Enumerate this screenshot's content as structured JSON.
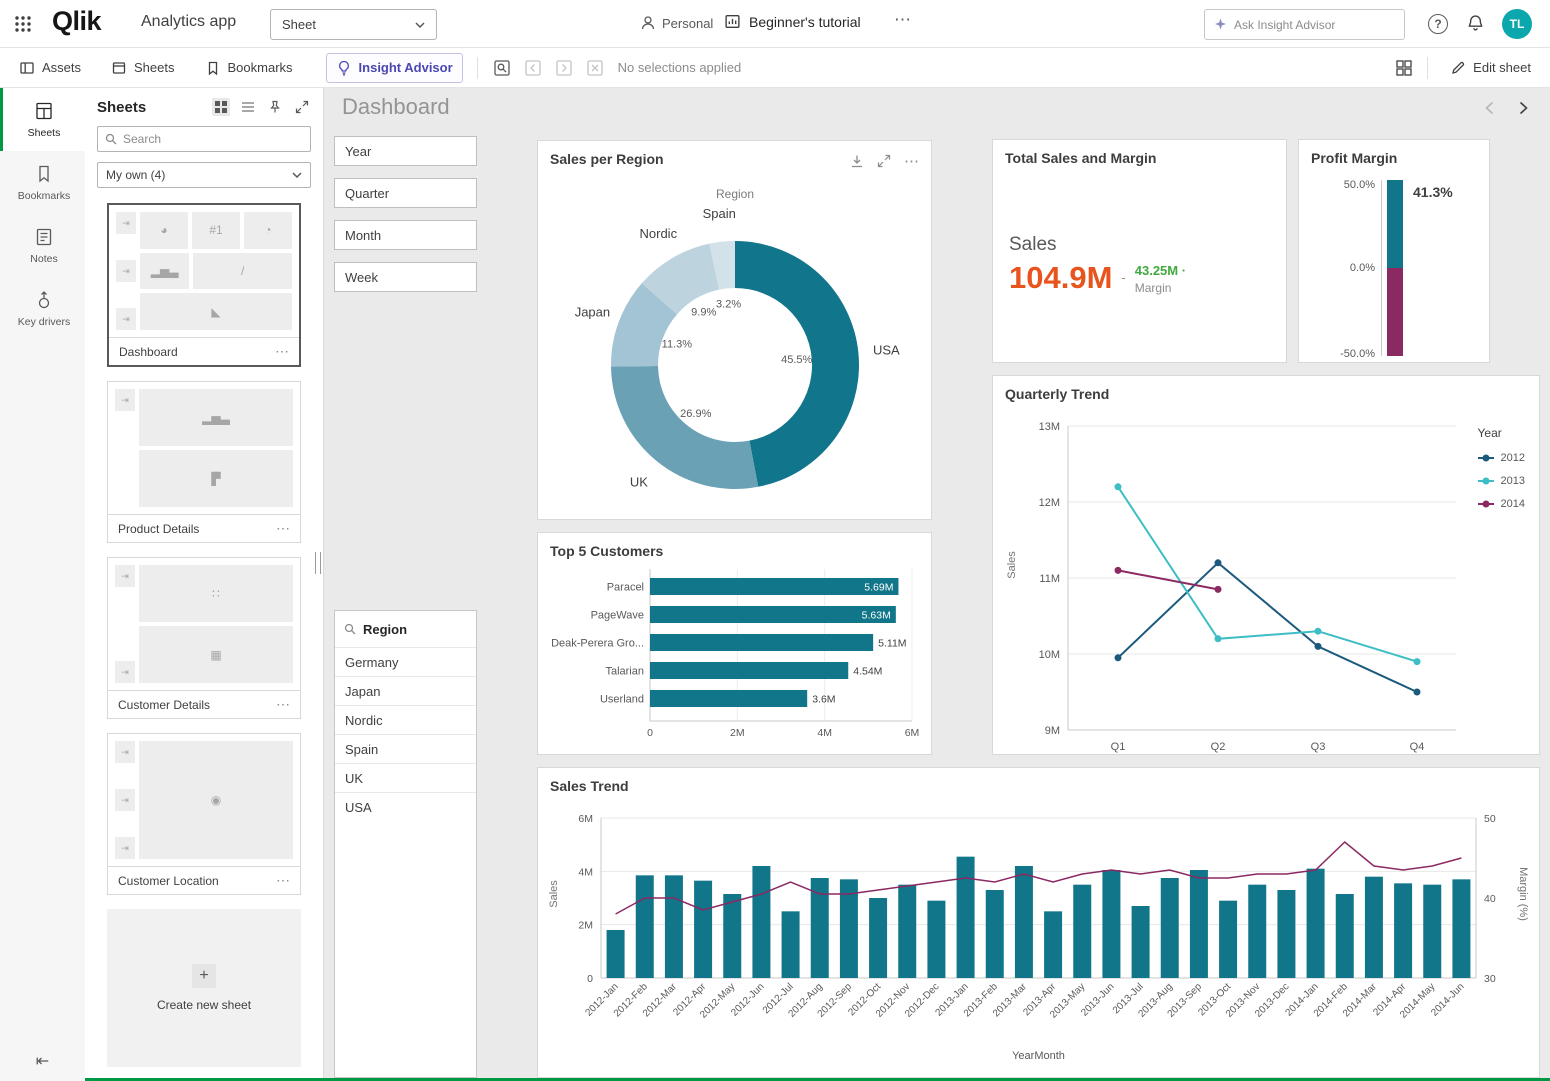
{
  "colors": {
    "accent_green": "#009845",
    "avatar_teal": "#0aa7ad",
    "insight_purple": "#4a47b3"
  },
  "topbar": {
    "logo_text": "Qlik",
    "app_name": "Analytics app",
    "sheet_selector_label": "Sheet",
    "personal_label": "Personal",
    "tutorial_label": "Beginner's tutorial",
    "insight_input_placeholder": "Ask Insight Advisor",
    "avatar_initials": "TL"
  },
  "toolbar": {
    "assets_label": "Assets",
    "sheets_label": "Sheets",
    "bookmarks_label": "Bookmarks",
    "insight_advisor_label": "Insight Advisor",
    "selection_status": "No selections applied",
    "edit_sheet_label": "Edit sheet"
  },
  "left_rail": {
    "items": [
      {
        "label": "Sheets",
        "active": true
      },
      {
        "label": "Bookmarks",
        "active": false
      },
      {
        "label": "Notes",
        "active": false
      },
      {
        "label": "Key drivers",
        "active": false
      }
    ]
  },
  "sheets_panel": {
    "title": "Sheets",
    "search_placeholder": "Search",
    "collection_filter": "My own (4)",
    "cards": [
      {
        "label": "Dashboard",
        "selected": true
      },
      {
        "label": "Product Details",
        "selected": false
      },
      {
        "label": "Customer Details",
        "selected": false
      },
      {
        "label": "Customer Location",
        "selected": false
      }
    ],
    "create_new_label": "Create new sheet"
  },
  "main": {
    "title": "Dashboard",
    "filter_boxes": [
      "Year",
      "Quarter",
      "Month",
      "Week"
    ],
    "region_listbox": {
      "title": "Region",
      "options": [
        "Germany",
        "Japan",
        "Nordic",
        "Spain",
        "UK",
        "USA"
      ]
    }
  },
  "chart_data": [
    {
      "id": "sales_per_region",
      "type": "pie",
      "donut": true,
      "title": "Sales per Region",
      "dimension_label": "Region",
      "labels": [
        "USA",
        "UK",
        "Japan",
        "Nordic",
        "Spain"
      ],
      "values": [
        45.5,
        26.9,
        11.3,
        9.9,
        3.2
      ],
      "value_labels": [
        "45.5%",
        "26.9%",
        "11.3%",
        "9.9%",
        "3.2%"
      ],
      "colors": [
        "#11758b",
        "#6aa1b5",
        "#a3c4d5",
        "#bdd3de",
        "#d3e1e9"
      ]
    },
    {
      "id": "total_sales_margin",
      "type": "kpi",
      "title": "Total Sales and Margin",
      "primary_label": "Sales",
      "primary_value": "104.9M",
      "primary_color": "#e8541d",
      "divider": "-",
      "secondary_value": "43.25M ·",
      "secondary_label": "Margin",
      "secondary_color": "#41a940"
    },
    {
      "id": "profit_margin",
      "type": "gauge",
      "title": "Profit Margin",
      "value": 41.3,
      "value_label": "41.3%",
      "min": -50,
      "max": 50,
      "ticks": [
        "50.0%",
        "0.0%",
        "-50.0%"
      ],
      "segments": [
        {
          "from": 0,
          "to": 50,
          "color": "#12768a"
        },
        {
          "from": -50,
          "to": 0,
          "color": "#8b2962"
        }
      ]
    },
    {
      "id": "quarterly_trend",
      "type": "line",
      "title": "Quarterly Trend",
      "x": [
        "Q1",
        "Q2",
        "Q3",
        "Q4"
      ],
      "ylabel": "Sales",
      "unit": "M",
      "ylim": [
        9,
        13
      ],
      "yticks": [
        "9M",
        "10M",
        "11M",
        "12M",
        "13M"
      ],
      "legend_title": "Year",
      "series": [
        {
          "name": "2012",
          "color": "#1b5a7d",
          "values": [
            9.95,
            11.2,
            10.1,
            9.5
          ]
        },
        {
          "name": "2013",
          "color": "#3dbdc5",
          "values": [
            12.2,
            10.2,
            10.3,
            9.9
          ]
        },
        {
          "name": "2014",
          "color": "#8b2962",
          "values": [
            11.1,
            10.85,
            null,
            null
          ]
        }
      ]
    },
    {
      "id": "top5_customers",
      "type": "bar",
      "orientation": "horizontal",
      "title": "Top 5 Customers",
      "categories": [
        "Paracel",
        "PageWave",
        "Deak-Perera Gro...",
        "Talarian",
        "Userland"
      ],
      "values": [
        5.69,
        5.63,
        5.11,
        4.54,
        3.6
      ],
      "value_labels": [
        "5.69M",
        "5.63M",
        "5.11M",
        "4.54M",
        "3.6M"
      ],
      "xticks": [
        "0",
        "2M",
        "4M",
        "6M"
      ],
      "xlim": [
        0,
        6
      ],
      "bar_color": "#12768a"
    },
    {
      "id": "sales_trend",
      "type": "combo",
      "title": "Sales Trend",
      "xlabel": "YearMonth",
      "ylabel_left": "Sales",
      "ylabel_right": "Margin (%)",
      "yticks_left": [
        "0",
        "2M",
        "4M",
        "6M"
      ],
      "ylim_left": [
        0,
        6
      ],
      "yticks_right": [
        "30",
        "40",
        "50"
      ],
      "ylim_right": [
        30,
        50
      ],
      "categories": [
        "2012-Jan",
        "2012-Feb",
        "2012-Mar",
        "2012-Apr",
        "2012-May",
        "2012-Jun",
        "2012-Jul",
        "2012-Aug",
        "2012-Sep",
        "2012-Oct",
        "2012-Nov",
        "2012-Dec",
        "2013-Jan",
        "2013-Feb",
        "2013-Mar",
        "2013-Apr",
        "2013-May",
        "2013-Jun",
        "2013-Jul",
        "2013-Aug",
        "2013-Sep",
        "2013-Oct",
        "2013-Nov",
        "2013-Dec",
        "2014-Jan",
        "2014-Feb",
        "2014-Mar",
        "2014-Apr",
        "2014-May",
        "2014-Jun"
      ],
      "bars": {
        "name": "Sales",
        "color": "#12768a",
        "values": [
          1.8,
          3.85,
          3.85,
          3.65,
          3.15,
          4.2,
          2.5,
          3.75,
          3.7,
          3.0,
          3.5,
          2.9,
          4.55,
          3.3,
          4.2,
          2.5,
          3.5,
          4.05,
          2.7,
          3.75,
          4.05,
          2.9,
          3.5,
          3.3,
          4.1,
          3.15,
          3.8,
          3.55,
          3.5,
          3.7
        ]
      },
      "line": {
        "name": "Margin (%)",
        "color": "#8b2962",
        "values": [
          38,
          40,
          40,
          38.5,
          39.5,
          40.5,
          42,
          40.5,
          40.5,
          41,
          41.5,
          42,
          42.5,
          42,
          43,
          42,
          43,
          43.5,
          43,
          43.5,
          42.5,
          42.5,
          43,
          43,
          43.5,
          47,
          44,
          43.5,
          44,
          45
        ]
      }
    }
  ]
}
